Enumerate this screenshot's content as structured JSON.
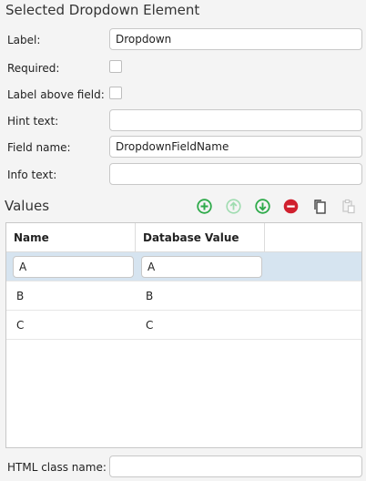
{
  "panel": {
    "title": "Selected Dropdown Element"
  },
  "fields": {
    "label": {
      "label": "Label:",
      "value": "Dropdown"
    },
    "required": {
      "label": "Required:",
      "checked": false
    },
    "label_above": {
      "label": "Label above field:",
      "checked": false
    },
    "hint_text": {
      "label": "Hint text:",
      "value": ""
    },
    "field_name": {
      "label": "Field name:",
      "value": "DropdownFieldName"
    },
    "info_text": {
      "label": "Info text:",
      "value": ""
    }
  },
  "values": {
    "title": "Values",
    "toolbar": {
      "add_icon": "add-circle-icon",
      "move_up_icon": "arrow-up-circle-icon",
      "move_down_icon": "arrow-down-circle-icon",
      "remove_icon": "remove-circle-icon",
      "copy_icon": "copy-icon",
      "paste_icon": "paste-icon"
    },
    "columns": [
      "Name",
      "Database Value"
    ],
    "rows": [
      {
        "name": "A",
        "db_value": "A",
        "selected": true
      },
      {
        "name": "B",
        "db_value": "B",
        "selected": false
      },
      {
        "name": "C",
        "db_value": "C",
        "selected": false
      }
    ]
  },
  "html_class": {
    "label": "HTML class name:",
    "value": ""
  },
  "colors": {
    "green": "#2eaa4a",
    "green_disabled": "#9fdcb0",
    "red": "#d0202e",
    "selection": "#d6e4f0"
  }
}
